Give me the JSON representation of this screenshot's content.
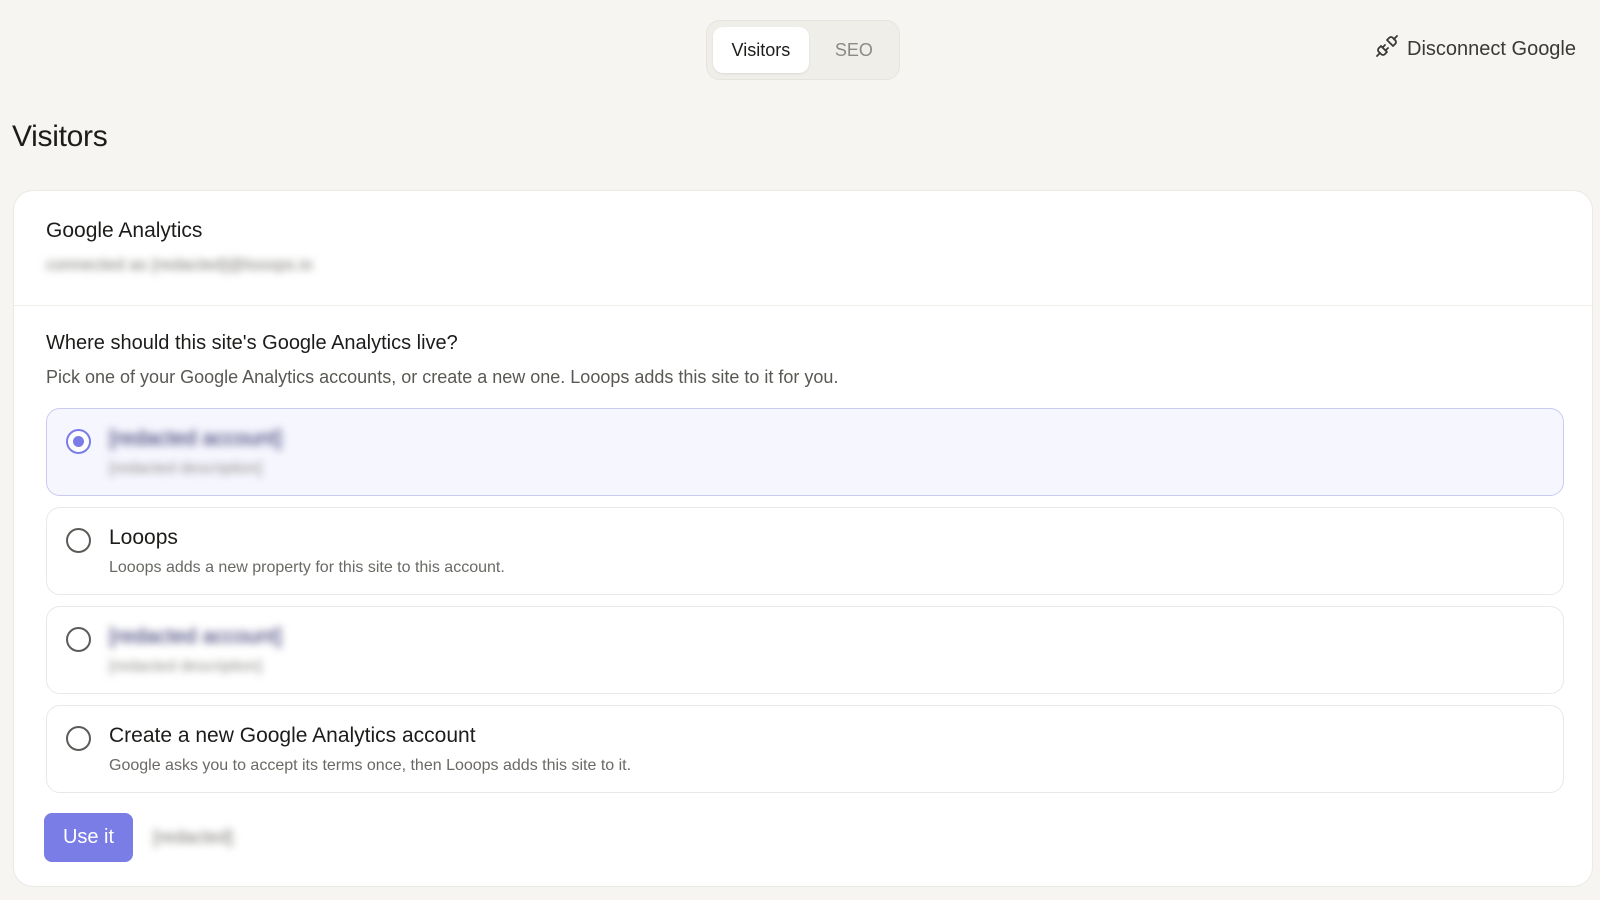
{
  "tabs": [
    {
      "label": "Visitors",
      "active": true
    },
    {
      "label": "SEO",
      "active": false
    }
  ],
  "header": {
    "disconnect_label": "Disconnect Google",
    "disconnect_icon": "unplug-icon"
  },
  "page_title": "Visitors",
  "card": {
    "title": "Google Analytics",
    "subtitle": "connected as [redacted]@looops.io"
  },
  "picker": {
    "question": "Where should this site's Google Analytics live?",
    "hint": "Pick one of your Google Analytics accounts, or create a new one. Looops adds this site to it for you.",
    "options": [
      {
        "name": "[redacted account]",
        "desc": "[redacted description]",
        "selected": true,
        "blurred": true
      },
      {
        "name": "Looops",
        "desc": "Looops adds a new property for this site to this account.",
        "selected": false,
        "blurred": false
      },
      {
        "name": "[redacted account]",
        "desc": "[redacted description]",
        "selected": false,
        "blurred": true
      },
      {
        "name": "Create a new Google Analytics account",
        "desc": "Google asks you to accept its terms once, then Looops adds this site to it.",
        "selected": false,
        "blurred": false
      }
    ]
  },
  "actions": {
    "primary_label": "Use it",
    "secondary_label": "[redacted]"
  },
  "colors": {
    "accent": "#7b7de7",
    "background": "#f6f5f2",
    "selected_bg": "#f6f6fe"
  }
}
